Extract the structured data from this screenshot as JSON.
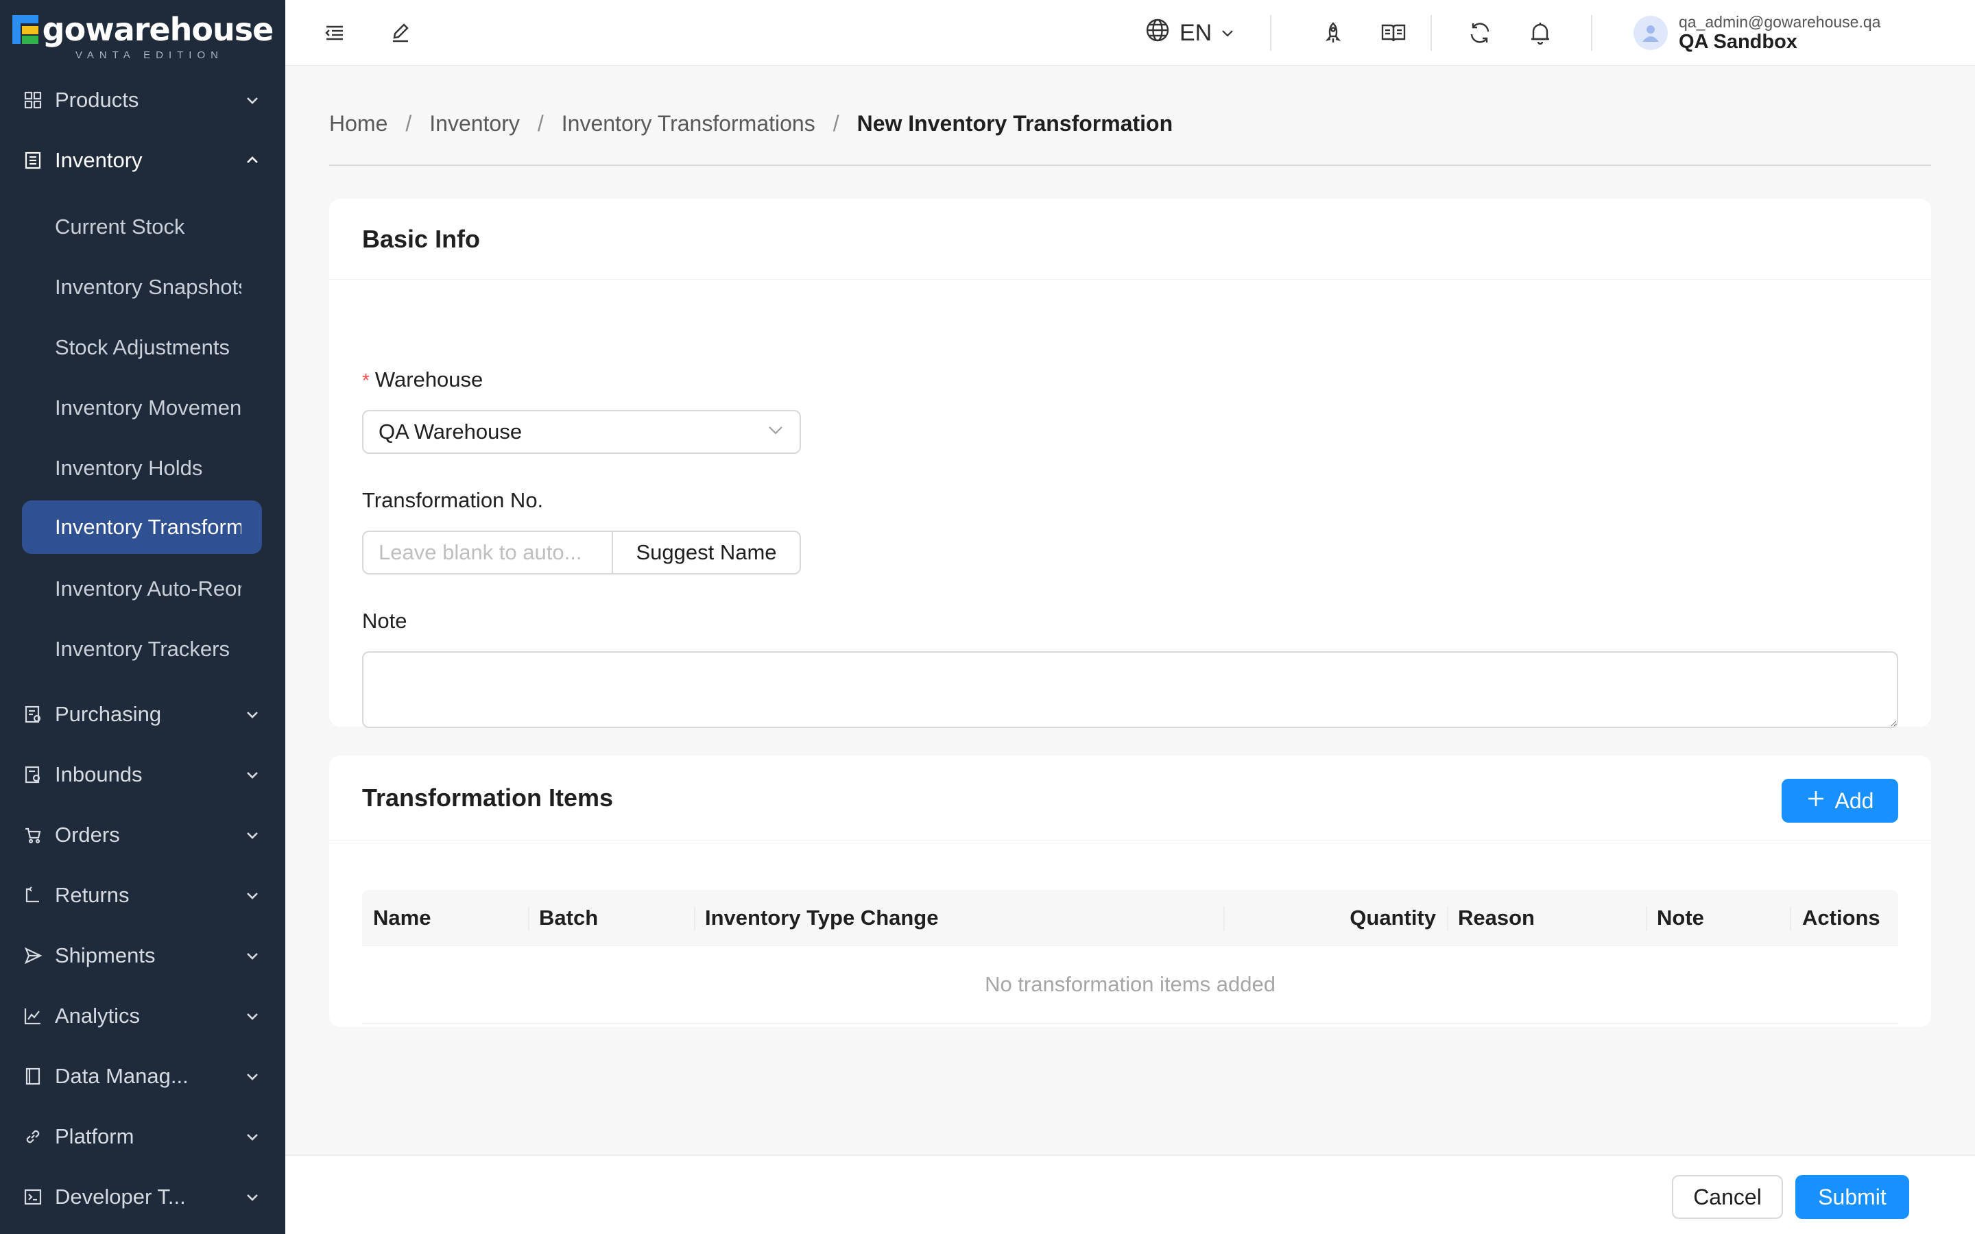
{
  "brand": {
    "name": "gowarehouse",
    "edition": "VANTA EDITION"
  },
  "sidebar": {
    "sections": [
      {
        "label": "Products",
        "icon": "grid-icon"
      },
      {
        "label": "Inventory",
        "icon": "inventory-icon"
      },
      {
        "label": "Purchasing",
        "icon": "purchasing-icon"
      },
      {
        "label": "Inbounds",
        "icon": "inbounds-icon"
      },
      {
        "label": "Orders",
        "icon": "cart-icon"
      },
      {
        "label": "Returns",
        "icon": "returns-icon"
      },
      {
        "label": "Shipments",
        "icon": "send-icon"
      },
      {
        "label": "Analytics",
        "icon": "chart-icon"
      },
      {
        "label": "Data Manag...",
        "icon": "book-icon"
      },
      {
        "label": "Platform",
        "icon": "link-icon"
      },
      {
        "label": "Developer T...",
        "icon": "terminal-icon"
      }
    ],
    "inventory_items": [
      "Current Stock",
      "Inventory Snapshots",
      "Stock Adjustments",
      "Inventory Movements",
      "Inventory Holds",
      "Inventory Transformations",
      "Inventory Auto-Reorder",
      "Inventory Trackers"
    ],
    "active_item_index": 5
  },
  "topbar": {
    "language": "EN",
    "user_email": "qa_admin@gowarehouse.qa",
    "org_name": "QA Sandbox"
  },
  "breadcrumb": {
    "items": [
      "Home",
      "Inventory",
      "Inventory Transformations"
    ],
    "current": "New Inventory Transformation",
    "separator": "/"
  },
  "basic_info": {
    "title": "Basic Info",
    "warehouse_label": "Warehouse",
    "warehouse_value": "QA Warehouse",
    "transformation_no_label": "Transformation No.",
    "transformation_no_placeholder": "Leave blank to auto...",
    "suggest_name_label": "Suggest Name",
    "note_label": "Note",
    "note_value": ""
  },
  "items_section": {
    "title": "Transformation Items",
    "add_label": "Add",
    "columns": [
      "Name",
      "Batch",
      "Inventory Type Change",
      "Quantity",
      "Reason",
      "Note",
      "Actions"
    ],
    "empty_text": "No transformation items added"
  },
  "footer": {
    "cancel_label": "Cancel",
    "submit_label": "Submit"
  },
  "colors": {
    "sidebar_bg": "#1f2a3a",
    "active_bg": "#2f5192",
    "primary": "#1890ff",
    "required": "#ff4d4f"
  }
}
